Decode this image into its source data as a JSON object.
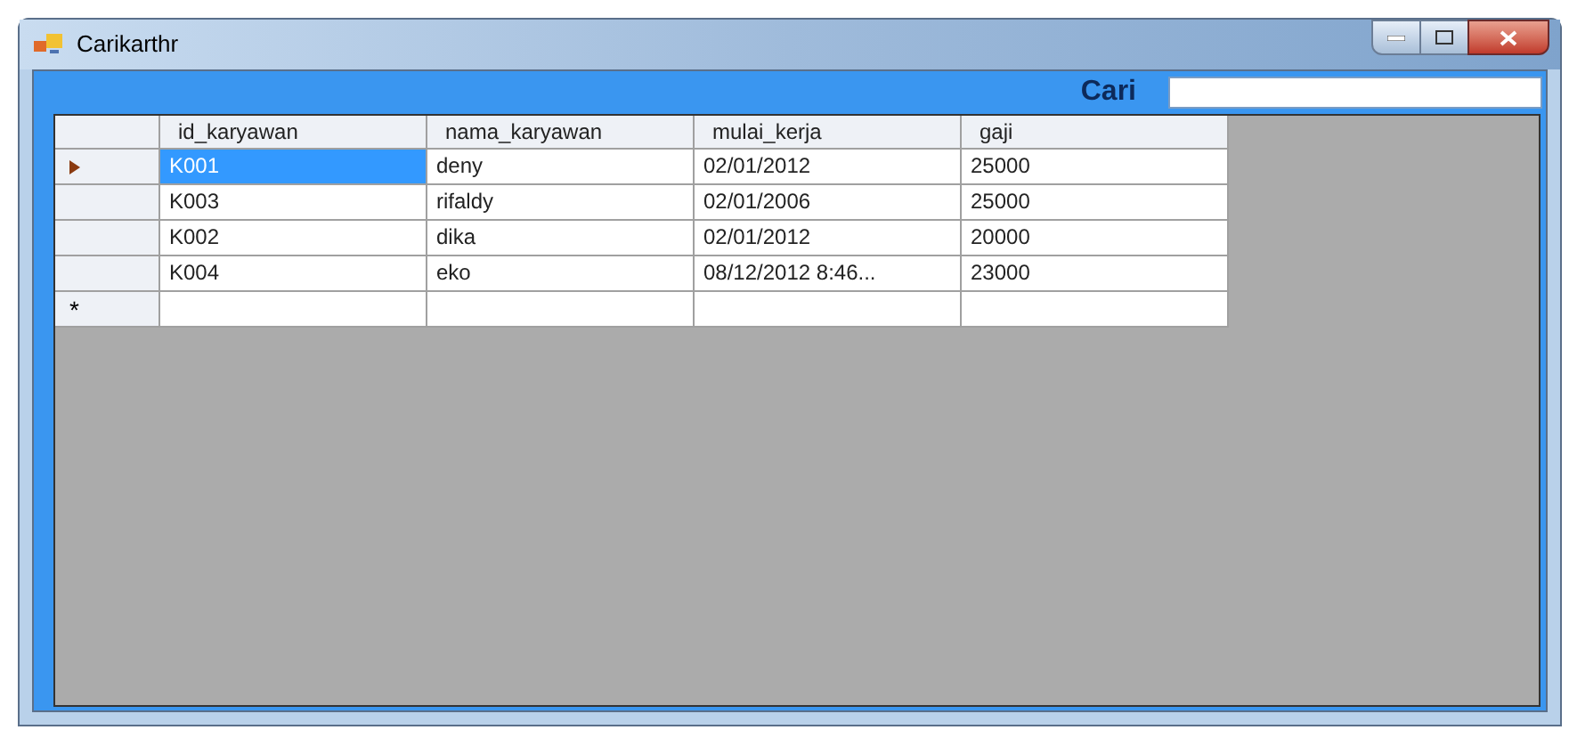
{
  "window": {
    "title": "Carikarthr"
  },
  "search": {
    "label": "Cari"
  },
  "table": {
    "columns": [
      "id_karyawan",
      "nama_karyawan",
      "mulai_kerja",
      "gaji"
    ],
    "rows": [
      {
        "kind": "data",
        "selected": true,
        "cells": [
          "K001",
          "deny",
          "02/01/2012",
          "25000"
        ]
      },
      {
        "kind": "data",
        "selected": false,
        "cells": [
          "K003",
          "rifaldy",
          "02/01/2006",
          "25000"
        ]
      },
      {
        "kind": "data",
        "selected": false,
        "cells": [
          "K002",
          "dika",
          "02/01/2012",
          "20000"
        ]
      },
      {
        "kind": "data",
        "selected": false,
        "cells": [
          "K004",
          "eko",
          "08/12/2012 8:46...",
          "23000"
        ]
      },
      {
        "kind": "new",
        "selected": false,
        "marker": "*"
      }
    ]
  }
}
